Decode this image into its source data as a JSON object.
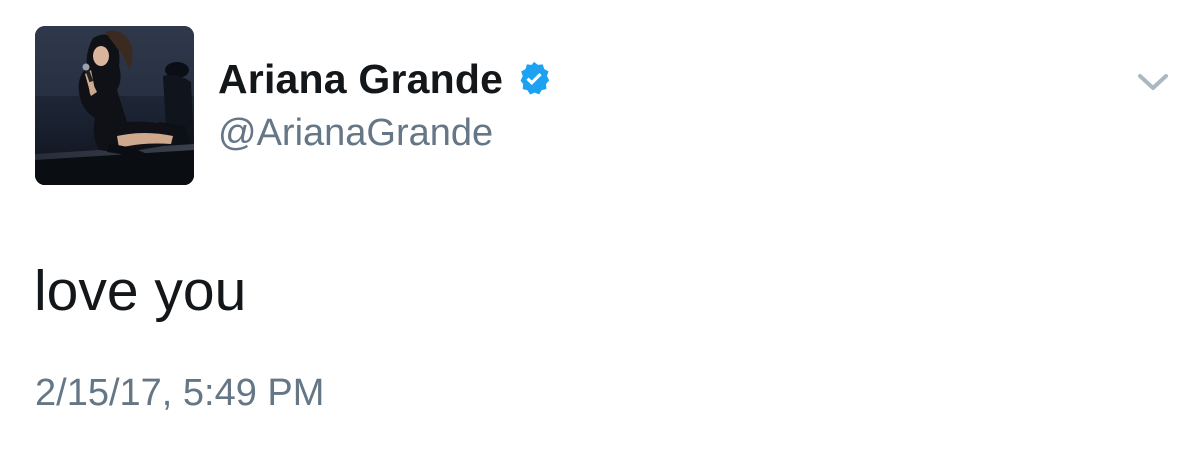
{
  "tweet": {
    "author": {
      "display_name": "Ariana Grande",
      "handle": "@ArianaGrande",
      "verified": true,
      "avatar_icon": "profile-photo"
    },
    "text": "love you",
    "timestamp": "2/15/17, 5:49 PM",
    "menu_icon": "chevron-down-icon"
  },
  "colors": {
    "name_text": "#14171a",
    "secondary_text": "#657786",
    "verified_badge": "#1da1f2",
    "chevron": "#aab8c2",
    "background": "#ffffff"
  }
}
